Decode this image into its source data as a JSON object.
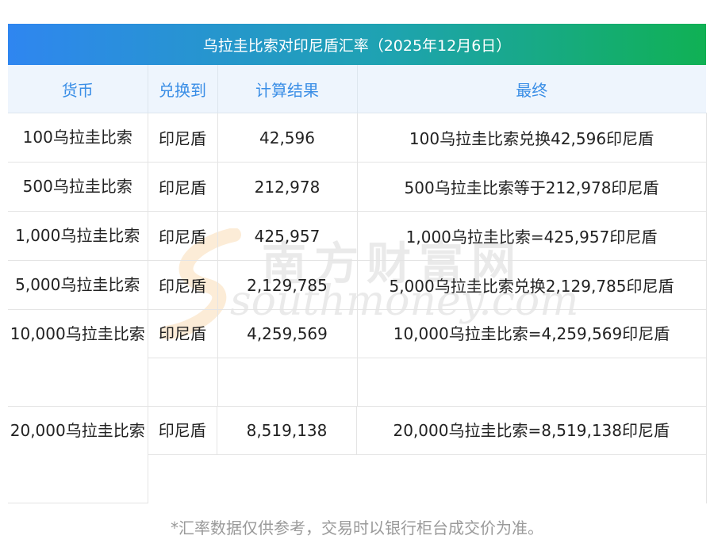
{
  "title": "乌拉圭比索对印尼盾汇率（2025年12月6日）",
  "columns": [
    "货币",
    "兑换到",
    "计算结果",
    "最终"
  ],
  "rows": [
    {
      "currency": "100乌拉圭比索",
      "target": "印尼盾",
      "result": "42,596",
      "final": "100乌拉圭比索兑换42,596印尼盾"
    },
    {
      "currency": "500乌拉圭比索",
      "target": "印尼盾",
      "result": "212,978",
      "final": "500乌拉圭比索等于212,978印尼盾"
    },
    {
      "currency": "1,000乌拉圭比索",
      "target": "印尼盾",
      "result": "425,957",
      "final": "1,000乌拉圭比索=425,957印尼盾"
    },
    {
      "currency": "5,000乌拉圭比索",
      "target": "印尼盾",
      "result": "2,129,785",
      "final": "5,000乌拉圭比索兑换2,129,785印尼盾"
    },
    {
      "currency": "10,000乌拉圭比索",
      "target": "印尼盾",
      "result": "4,259,569",
      "final": "10,000乌拉圭比索=4,259,569印尼盾"
    },
    {
      "currency": "20,000乌拉圭比索",
      "target": "印尼盾",
      "result": "8,519,138",
      "final": "20,000乌拉圭比索=8,519,138印尼盾"
    }
  ],
  "watermark": {
    "chinese": "南方财富网",
    "english": "southmoney.com"
  },
  "footnote": "*汇率数据仅供参考，交易时以银行柜台成交价为准。",
  "colors": {
    "title_start": "#2f86f0",
    "title_end": "#10b154",
    "header_text": "#3a8ee6",
    "header_bg": "#eef5fd"
  }
}
